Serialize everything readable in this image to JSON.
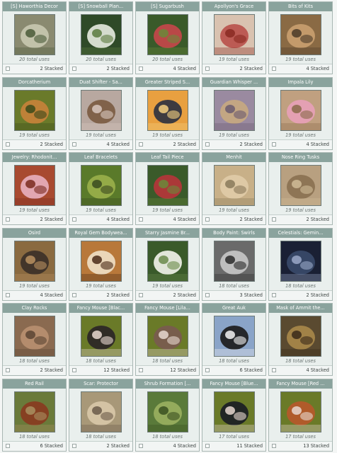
{
  "items": [
    {
      "name": "[S] Haworthia Decor",
      "uses": "20 total uses",
      "stacked": "2 Stacked",
      "icon": "succulent-icon",
      "palette": [
        "#8a8a70",
        "#c8c8b0",
        "#4a5a38"
      ]
    },
    {
      "name": "[S] Snowball Plan...",
      "uses": "20 total uses",
      "stacked": "2 Stacked",
      "icon": "white-flowers-icon",
      "palette": [
        "#2f4a28",
        "#e8ece0",
        "#5b7a3e"
      ]
    },
    {
      "name": "[S] Sugarbush",
      "uses": "20 total uses",
      "stacked": "4 Stacked",
      "icon": "sugarbush-plant-icon",
      "palette": [
        "#3a5a2a",
        "#c8464a",
        "#6a8a3a"
      ]
    },
    {
      "name": "Apollyon's Grace",
      "uses": "19 total uses",
      "stacked": "2 Stacked",
      "icon": "red-fire-tail-icon",
      "palette": [
        "#d9c2b0",
        "#b8504a",
        "#8a2a22"
      ]
    },
    {
      "name": "Bits of Kits",
      "uses": "19 total uses",
      "stacked": "4 Stacked",
      "icon": "kittens-icon",
      "palette": [
        "#8a6a44",
        "#c9a070",
        "#4a3a28"
      ]
    },
    {
      "name": "Dorcatherium",
      "uses": "19 total uses",
      "stacked": "2 Stacked",
      "icon": "small-deer-icon",
      "palette": [
        "#6a7a2a",
        "#c8823a",
        "#3a4a1a"
      ]
    },
    {
      "name": "Duat Shifter - Sa...",
      "uses": "19 total uses",
      "stacked": "4 Stacked",
      "icon": "falcon-lioness-icon",
      "palette": [
        "#b8a8a0",
        "#7a5a40",
        "#d8c8c0"
      ]
    },
    {
      "name": "Greater Striped S...",
      "uses": "19 total uses",
      "stacked": "2 Stacked",
      "icon": "swallow-bird-icon",
      "palette": [
        "#e8a040",
        "#2a3040",
        "#f4d080"
      ]
    },
    {
      "name": "Guardian Whisper ...",
      "uses": "19 total uses",
      "stacked": "2 Stacked",
      "icon": "lioness-icon",
      "palette": [
        "#9a8aa0",
        "#c8a880",
        "#6a5a70"
      ]
    },
    {
      "name": "Impala Lily",
      "uses": "19 total uses",
      "stacked": "4 Stacked",
      "icon": "pink-lily-icon",
      "palette": [
        "#c0a080",
        "#e8a0b8",
        "#8a6a4a"
      ]
    },
    {
      "name": "Jewelry: Rhodonit...",
      "uses": "19 total uses",
      "stacked": "2 Stacked",
      "icon": "pink-jewelry-icon",
      "palette": [
        "#a84a30",
        "#e8b0c0",
        "#7a2a20"
      ]
    },
    {
      "name": "Leaf Bracelets",
      "uses": "19 total uses",
      "stacked": "4 Stacked",
      "icon": "leaf-bracelet-icon",
      "palette": [
        "#5a7a2a",
        "#9ab04a",
        "#3a4a20"
      ]
    },
    {
      "name": "Leaf Tail Piece",
      "uses": "19 total uses",
      "stacked": "4 Stacked",
      "icon": "leaf-tail-icon",
      "palette": [
        "#3a5a2a",
        "#b8343a",
        "#6a8a3a"
      ]
    },
    {
      "name": "Menhit",
      "uses": "19 total uses",
      "stacked": "2 Stacked",
      "icon": "lioness-face-icon",
      "palette": [
        "#c8b088",
        "#e0cca8",
        "#8a7a5a"
      ]
    },
    {
      "name": "Nose Ring Tusks",
      "uses": "19 total uses",
      "stacked": "2 Stacked",
      "icon": "cougar-face-icon",
      "palette": [
        "#b8a080",
        "#8a7050",
        "#d0bc98"
      ]
    },
    {
      "name": "Osird",
      "uses": "19 total uses",
      "stacked": "4 Stacked",
      "icon": "dagger-icon",
      "palette": [
        "#8a6a40",
        "#3a3028",
        "#b89060"
      ]
    },
    {
      "name": "Royal Gem Bodywea...",
      "uses": "19 total uses",
      "stacked": "2 Stacked",
      "icon": "tiger-face-icon",
      "palette": [
        "#b8783a",
        "#f0e0c8",
        "#4a2a18"
      ]
    },
    {
      "name": "Starry Jasmine Br...",
      "uses": "19 total uses",
      "stacked": "2 Stacked",
      "icon": "jasmine-flowers-icon",
      "palette": [
        "#3a5a2a",
        "#f4f4ec",
        "#6a8a4a"
      ]
    },
    {
      "name": "Body Paint: Swirls",
      "uses": "18 total uses",
      "stacked": "3 Stacked",
      "icon": "swirl-paint-face-icon",
      "palette": [
        "#6a6a6a",
        "#c8c8c8",
        "#2a2a2a"
      ]
    },
    {
      "name": "Celestials: Gemin...",
      "uses": "18 total uses",
      "stacked": "2 Stacked",
      "icon": "twin-cats-icon",
      "palette": [
        "#1a2034",
        "#3a4a6a",
        "#9aa8c8"
      ]
    },
    {
      "name": "Clay Rocks",
      "uses": "18 total uses",
      "stacked": "2 Stacked",
      "icon": "rock-icon",
      "palette": [
        "#8a6a50",
        "#b89070",
        "#5a4434"
      ]
    },
    {
      "name": "Fancy Mouse [Blac...",
      "uses": "18 total uses",
      "stacked": "12 Stacked",
      "icon": "black-mouse-icon",
      "palette": [
        "#6a7a28",
        "#2a2426",
        "#e8d8d0"
      ]
    },
    {
      "name": "Fancy Mouse [Lila...",
      "uses": "18 total uses",
      "stacked": "12 Stacked",
      "icon": "lilac-mouse-icon",
      "palette": [
        "#6a7a28",
        "#7a5a50",
        "#e8d8d0"
      ]
    },
    {
      "name": "Great Auk",
      "uses": "18 total uses",
      "stacked": "6 Stacked",
      "icon": "auk-bird-icon",
      "palette": [
        "#8aa4c8",
        "#1a1a1a",
        "#f4f4f4"
      ]
    },
    {
      "name": "Mask of Ammit the...",
      "uses": "18 total uses",
      "stacked": "4 Stacked",
      "icon": "beast-mask-icon",
      "palette": [
        "#5a4a30",
        "#a8884a",
        "#3a2a1a"
      ]
    },
    {
      "name": "Red Rail",
      "uses": "18 total uses",
      "stacked": "6 Stacked",
      "icon": "rail-bird-icon",
      "palette": [
        "#6a7a3a",
        "#8a3a20",
        "#a89060"
      ]
    },
    {
      "name": "Scar: Protector",
      "uses": "18 total uses",
      "stacked": "2 Stacked",
      "icon": "lion-face-icon",
      "palette": [
        "#a89878",
        "#d8c8a8",
        "#6a5a4a"
      ]
    },
    {
      "name": "Shrub Formation [...",
      "uses": "18 total uses",
      "stacked": "4 Stacked",
      "icon": "grass-shrub-icon",
      "palette": [
        "#5a7a3a",
        "#9ab060",
        "#3a5020"
      ]
    },
    {
      "name": "Fancy Mouse [Blue...",
      "uses": "17 total uses",
      "stacked": "11 Stacked",
      "icon": "blue-mouse-icon",
      "palette": [
        "#6a7a28",
        "#1a1c24",
        "#e8d8d0"
      ]
    },
    {
      "name": "Fancy Mouse [Red ...",
      "uses": "17 total uses",
      "stacked": "13 Stacked",
      "icon": "red-mouse-icon",
      "palette": [
        "#6a7a28",
        "#b8582a",
        "#e8d8d0"
      ]
    }
  ]
}
